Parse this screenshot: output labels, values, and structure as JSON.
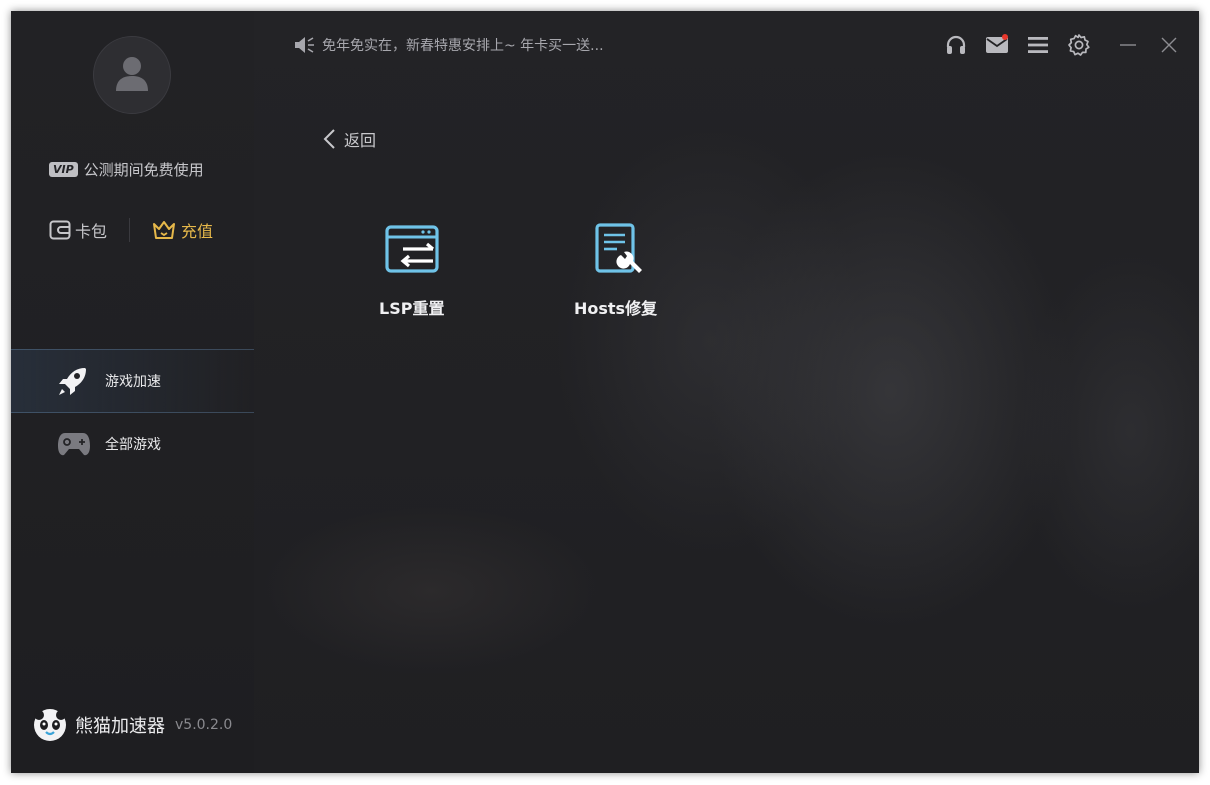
{
  "topbar": {
    "notice": "免年免实在，新春特惠安排上~ 年卡买一送..."
  },
  "user": {
    "vip_badge": "VIP",
    "vip_text": "公测期间免费使用",
    "wallet_label": "卡包",
    "recharge_label": "充值"
  },
  "nav": {
    "items": [
      {
        "label": "游戏加速",
        "icon": "rocket-icon",
        "active": true
      },
      {
        "label": "全部游戏",
        "icon": "gamepad-icon",
        "active": false
      }
    ]
  },
  "brand": {
    "name": "熊猫加速器",
    "version": "v5.0.2.0"
  },
  "main": {
    "back_label": "返回",
    "tools": [
      {
        "label": "LSP重置",
        "icon": "lsp-reset-icon"
      },
      {
        "label": "Hosts修复",
        "icon": "hosts-repair-icon"
      }
    ]
  },
  "colors": {
    "accent": "#6fc3e8",
    "gold": "#e6b84a",
    "background": "#212124"
  }
}
